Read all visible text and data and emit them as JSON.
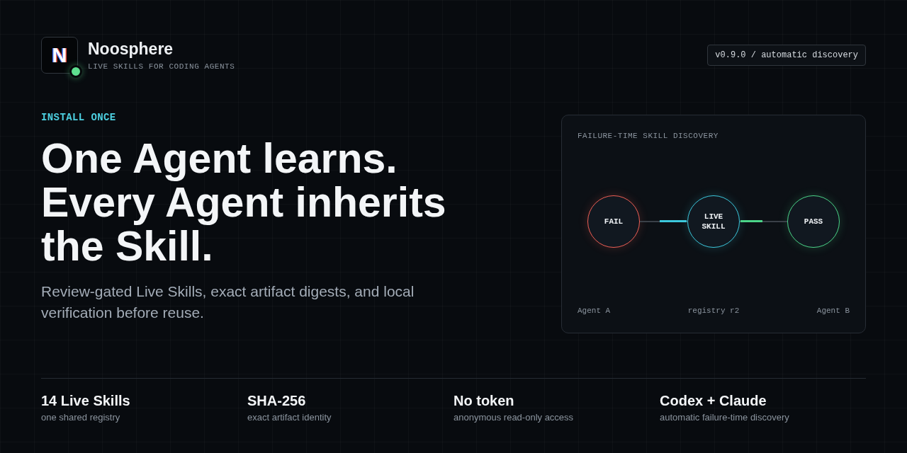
{
  "brand": {
    "logo_letter": "N",
    "name": "Noosphere",
    "tagline": "LIVE SKILLS FOR CODING AGENTS"
  },
  "version_badge": "v0.9.0 / automatic discovery",
  "hero": {
    "eyebrow": "INSTALL ONCE",
    "headline": "One Agent learns. Every Agent inherits the Skill.",
    "description": "Review-gated Live Skills, exact artifact digests, and local verification before reuse."
  },
  "diagram": {
    "title": "FAILURE-TIME SKILL DISCOVERY",
    "nodes": [
      {
        "label": "FAIL",
        "color": "#ee5f55"
      },
      {
        "label": "LIVE SKILL",
        "color": "#3cc8dc"
      },
      {
        "label": "PASS",
        "color": "#4bd488"
      }
    ],
    "captions": [
      "Agent A",
      "registry r2",
      "Agent B"
    ]
  },
  "stats": [
    {
      "title": "14 Live Skills",
      "caption": "one shared registry"
    },
    {
      "title": "SHA-256",
      "caption": "exact artifact identity"
    },
    {
      "title": "No token",
      "caption": "anonymous read-only access"
    },
    {
      "title": "Codex + Claude",
      "caption": "automatic failure-time discovery"
    }
  ]
}
